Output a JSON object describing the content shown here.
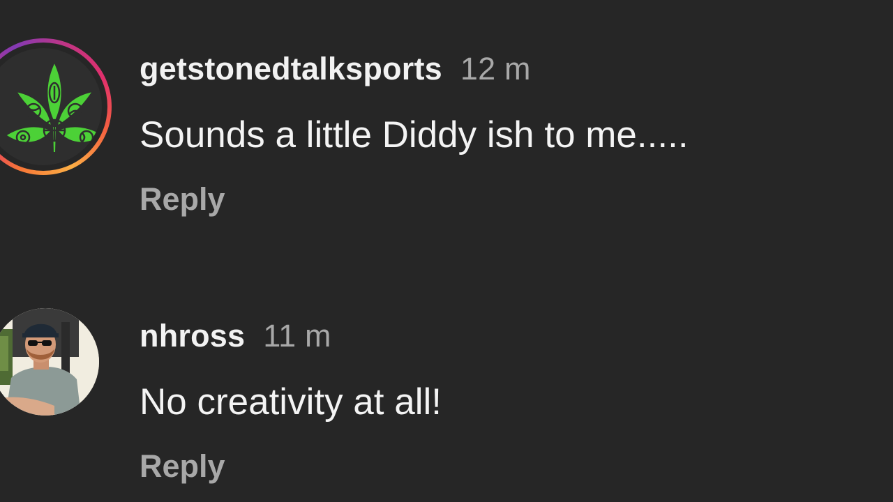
{
  "comments": [
    {
      "username": "getstonedtalksports",
      "timestamp": "12 m",
      "text": "Sounds a little Diddy ish to me.....",
      "reply_label": "Reply",
      "avatar_icon": "cannabis-leaf-sports-balls-logo",
      "avatar_has_story_ring": true
    },
    {
      "username": "nhross",
      "timestamp": "11 m",
      "text": "No creativity at all!",
      "reply_label": "Reply",
      "avatar_icon": "profile-photo"
    }
  ],
  "colors": {
    "background": "#262626",
    "text": "#f4f4f4",
    "muted": "#a8a8a8",
    "logo_green": "#4cd137"
  }
}
